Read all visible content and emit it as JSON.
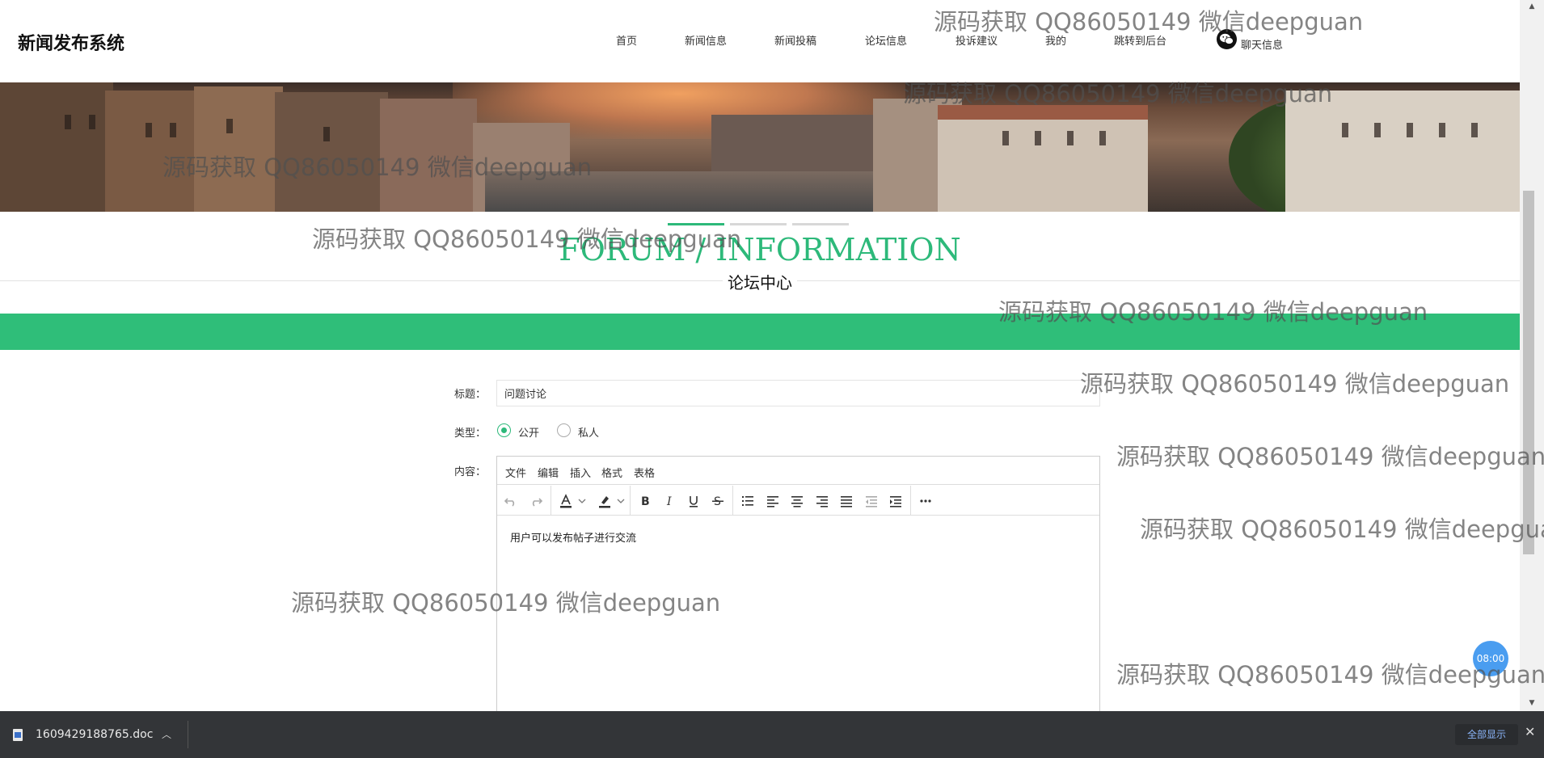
{
  "header": {
    "brand": "新闻发布系统",
    "nav": [
      {
        "label": "首页"
      },
      {
        "label": "新闻信息"
      },
      {
        "label": "新闻投稿"
      },
      {
        "label": "论坛信息"
      },
      {
        "label": "投诉建议"
      },
      {
        "label": "我的"
      },
      {
        "label": "跳转到后台"
      }
    ],
    "chat": {
      "label": "聊天信息",
      "icon": "wechat-icon"
    }
  },
  "carousel": {
    "slides": 3,
    "active_index": 0
  },
  "section": {
    "title_en": "FORUM / INFORMATION",
    "title_cn": "论坛中心",
    "accent_color": "#2db97a"
  },
  "form": {
    "title_label": "标题：",
    "title_value": "问题讨论",
    "type_label": "类型：",
    "type_options": [
      {
        "label": "公开",
        "selected": true
      },
      {
        "label": "私人",
        "selected": false
      }
    ],
    "content_label": "内容：",
    "editor": {
      "menu": [
        "文件",
        "编辑",
        "插入",
        "格式",
        "表格"
      ],
      "toolbar": [
        "undo-icon",
        "redo-icon",
        "text-color-icon",
        "highlight-icon",
        "bold-icon",
        "italic-icon",
        "underline-icon",
        "strikethrough-icon",
        "bullet-list-icon",
        "align-left-icon",
        "align-center-icon",
        "align-right-icon",
        "align-justify-icon",
        "outdent-icon",
        "indent-icon",
        "more-icon"
      ],
      "content": "用户可以发布帖子进行交流"
    }
  },
  "bubble": {
    "text": "08:00"
  },
  "watermark": "源码获取 QQ86050149 微信deepguan",
  "download_bar": {
    "filename": "1609429188765.doc",
    "show_all": "全部显示",
    "close": "✕"
  }
}
